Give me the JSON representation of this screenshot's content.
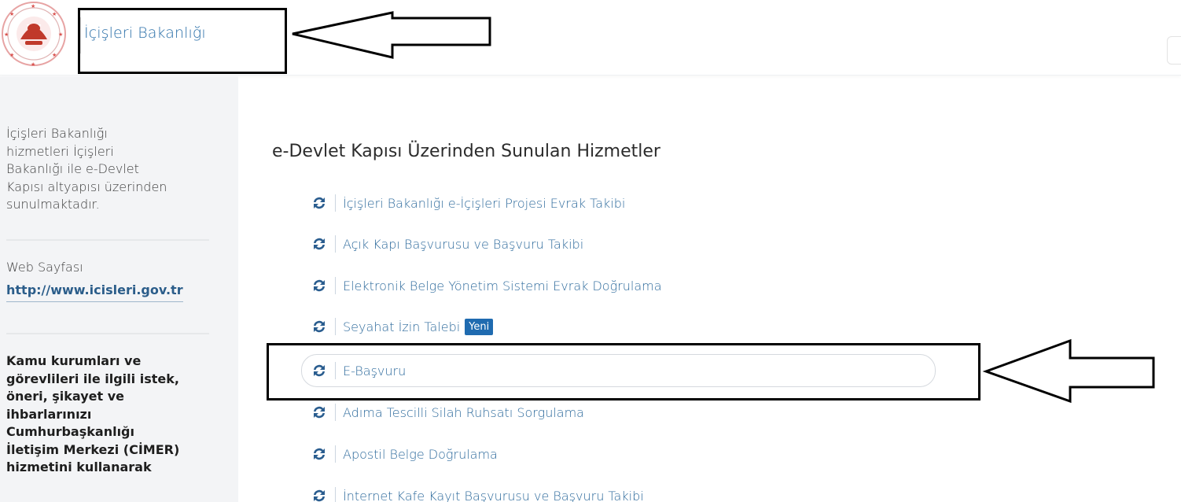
{
  "header": {
    "title": "İçişleri Bakanlığı",
    "logo_icon": "ministry-seal-icon"
  },
  "sidebar": {
    "description": [
      "İçişleri Bakanlığı",
      "hizmetleri İçişleri",
      "Bakanlığı ile e-Devlet",
      "Kapısı altyapısı üzerinden",
      "sunulmaktadır."
    ],
    "web_label": "Web Sayfası",
    "web_link": "http://www.icisleri.gov.tr",
    "cimer_text": [
      "Kamu kurumları ve",
      "görevlileri ile ilgili istek,",
      "öneri, şikayet ve",
      "ihbarlarınızı",
      "Cumhurbaşkanlığı",
      "İletişim Merkezi (CİMER)",
      "hizmetini kullanarak"
    ]
  },
  "main": {
    "heading": "e-Devlet Kapısı Üzerinden Sunulan Hizmetler",
    "services": [
      {
        "label": "İçişleri Bakanlığı e-İçişleri Projesi Evrak Takibi",
        "badge": ""
      },
      {
        "label": "Açık Kapı Başvurusu ve Başvuru Takibi",
        "badge": ""
      },
      {
        "label": "Elektronik Belge Yönetim Sistemi Evrak Doğrulama",
        "badge": ""
      },
      {
        "label": "Seyahat İzin Talebi",
        "badge": "Yeni"
      },
      {
        "label": "E-Başvuru",
        "badge": ""
      },
      {
        "label": "Adıma Tescilli Silah Ruhsatı Sorgulama",
        "badge": ""
      },
      {
        "label": "Apostil Belge Doğrulama",
        "badge": ""
      },
      {
        "label": "İnternet Kafe Kayıt Başvurusu ve Başvuru Takibi",
        "badge": ""
      }
    ],
    "service_icon": "refresh-arrows-icon"
  },
  "colors": {
    "link_blue": "#2d6a9c",
    "badge_blue": "#1f6bb0",
    "sidebar_bg": "#f3f4f6",
    "seal_red": "#c0392b"
  }
}
